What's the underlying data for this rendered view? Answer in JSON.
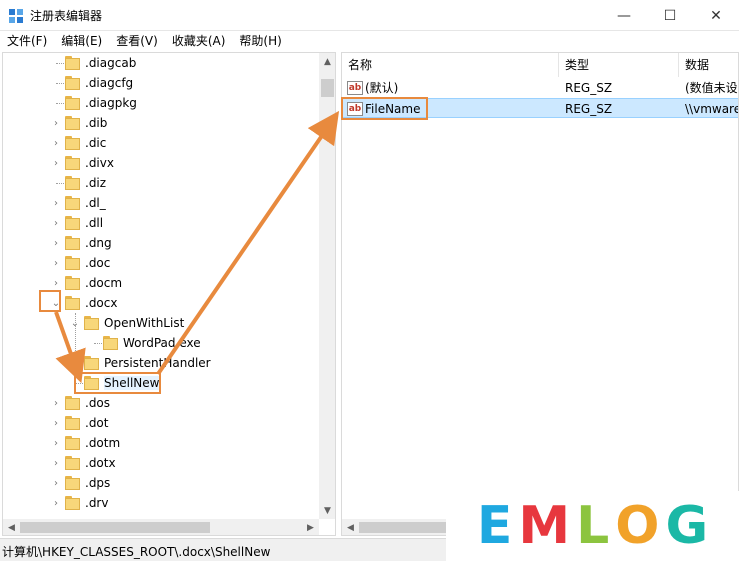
{
  "window": {
    "title": "注册表编辑器",
    "minimize_glyph": "—",
    "maximize_glyph": "☐",
    "close_glyph": "✕"
  },
  "menu": [
    "文件(F)",
    "编辑(E)",
    "查看(V)",
    "收藏夹(A)",
    "帮助(H)"
  ],
  "tree": {
    "items": [
      {
        "label": ".diagcab",
        "expander": "none"
      },
      {
        "label": ".diagcfg",
        "expander": "none"
      },
      {
        "label": ".diagpkg",
        "expander": "none"
      },
      {
        "label": ".dib",
        "expander": "collapsed"
      },
      {
        "label": ".dic",
        "expander": "collapsed"
      },
      {
        "label": ".divx",
        "expander": "collapsed"
      },
      {
        "label": ".diz",
        "expander": "none"
      },
      {
        "label": ".dl_",
        "expander": "collapsed"
      },
      {
        "label": ".dll",
        "expander": "collapsed"
      },
      {
        "label": ".dng",
        "expander": "collapsed"
      },
      {
        "label": ".doc",
        "expander": "collapsed"
      },
      {
        "label": ".docm",
        "expander": "collapsed"
      },
      {
        "label": ".docx",
        "expander": "expanded"
      },
      {
        "label": "OpenWithList",
        "expander": "expanded"
      },
      {
        "label": "WordPad.exe",
        "expander": "none"
      },
      {
        "label": "PersistentHandler",
        "expander": "none"
      },
      {
        "label": "ShellNew",
        "expander": "none",
        "selected": true
      },
      {
        "label": ".dos",
        "expander": "collapsed"
      },
      {
        "label": ".dot",
        "expander": "collapsed"
      },
      {
        "label": ".dotm",
        "expander": "collapsed"
      },
      {
        "label": ".dotx",
        "expander": "collapsed"
      },
      {
        "label": ".dps",
        "expander": "collapsed"
      },
      {
        "label": ".drv",
        "expander": "collapsed"
      }
    ]
  },
  "values": {
    "columns": {
      "name": "名称",
      "type": "类型",
      "data": "数据"
    },
    "rows": [
      {
        "name": "(默认)",
        "type": "REG_SZ",
        "data": "(数值未设"
      },
      {
        "name": "FileName",
        "type": "REG_SZ",
        "data": "\\\\vmware",
        "selected": true
      }
    ]
  },
  "status": {
    "path": "计算机\\HKEY_CLASSES_ROOT\\.docx\\ShellNew"
  },
  "watermark": {
    "letters": [
      "E",
      "M",
      "L",
      "O",
      "G"
    ],
    "colors": [
      "#1fa8e0",
      "#e7373e",
      "#8cc43f",
      "#f1a22a",
      "#1bb8a6"
    ]
  },
  "colors": {
    "highlight": "#e88a3e",
    "selection": "#cce8ff"
  }
}
